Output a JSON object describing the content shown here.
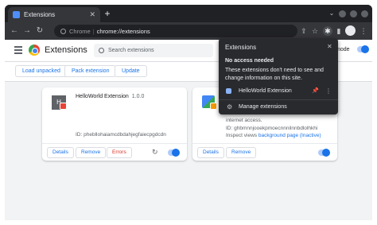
{
  "tab": {
    "title": "Extensions",
    "close": "✕"
  },
  "new_tab": "+",
  "omnibox": {
    "scheme": "Chrome",
    "separator": "|",
    "url": "chrome://extensions"
  },
  "page": {
    "title": "Extensions",
    "search_placeholder": "Search extensions",
    "dev_mode_label": "mode",
    "buttons": {
      "load_unpacked": "Load unpacked",
      "pack_extension": "Pack extension",
      "update": "Update"
    }
  },
  "card1": {
    "logo_letter": "H",
    "name": "HelloWorld Extension",
    "version": "1.0.0",
    "id_text": "ID: phebllohaiamcdbdahjegfaiecpgdcdn",
    "details": "Details",
    "remove": "Remove",
    "errors": "Errors"
  },
  "card2": {
    "line1": "internet access.",
    "line2": "ID: ghbmnnjooekpmoecnnnilnnbdlolhkhi",
    "line3_prefix": "Inspect views",
    "line3_link": "background page (Inactive)",
    "details": "Details",
    "remove": "Remove"
  },
  "popup": {
    "title": "Extensions",
    "close": "✕",
    "heading": "No access needed",
    "description": "These extensions don't need to see and change information on this site.",
    "extension_name": "HelloWorld Extension",
    "manage": "Manage extensions"
  },
  "icons": {
    "pin": "📌",
    "more": "⋮",
    "gear": "⚙",
    "reload": "↻",
    "back": "←",
    "forward": "→",
    "refresh": "↻",
    "share": "⇪",
    "star": "☆",
    "puzzle": "✱",
    "sidebar": "▮",
    "menu": "⋮",
    "chevron": "⌄"
  }
}
